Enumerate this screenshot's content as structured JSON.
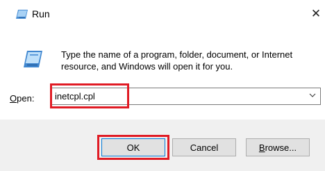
{
  "window": {
    "title": "Run"
  },
  "icons": {
    "title": "run-icon",
    "dialog": "run-icon",
    "close": "close-icon",
    "dropdown": "chevron-down-icon"
  },
  "description": "Type the name of a program, folder, document, or Internet resource, and Windows will open it for you.",
  "open": {
    "label_underlined": "O",
    "label_rest": "pen:",
    "value": "inetcpl.cpl"
  },
  "buttons": {
    "ok": "OK",
    "cancel": "Cancel",
    "browse_underlined": "B",
    "browse_rest": "rowse..."
  },
  "colors": {
    "highlight": "#e01b24",
    "accent": "#0078d7",
    "footer_bg": "#f0f0f0"
  }
}
